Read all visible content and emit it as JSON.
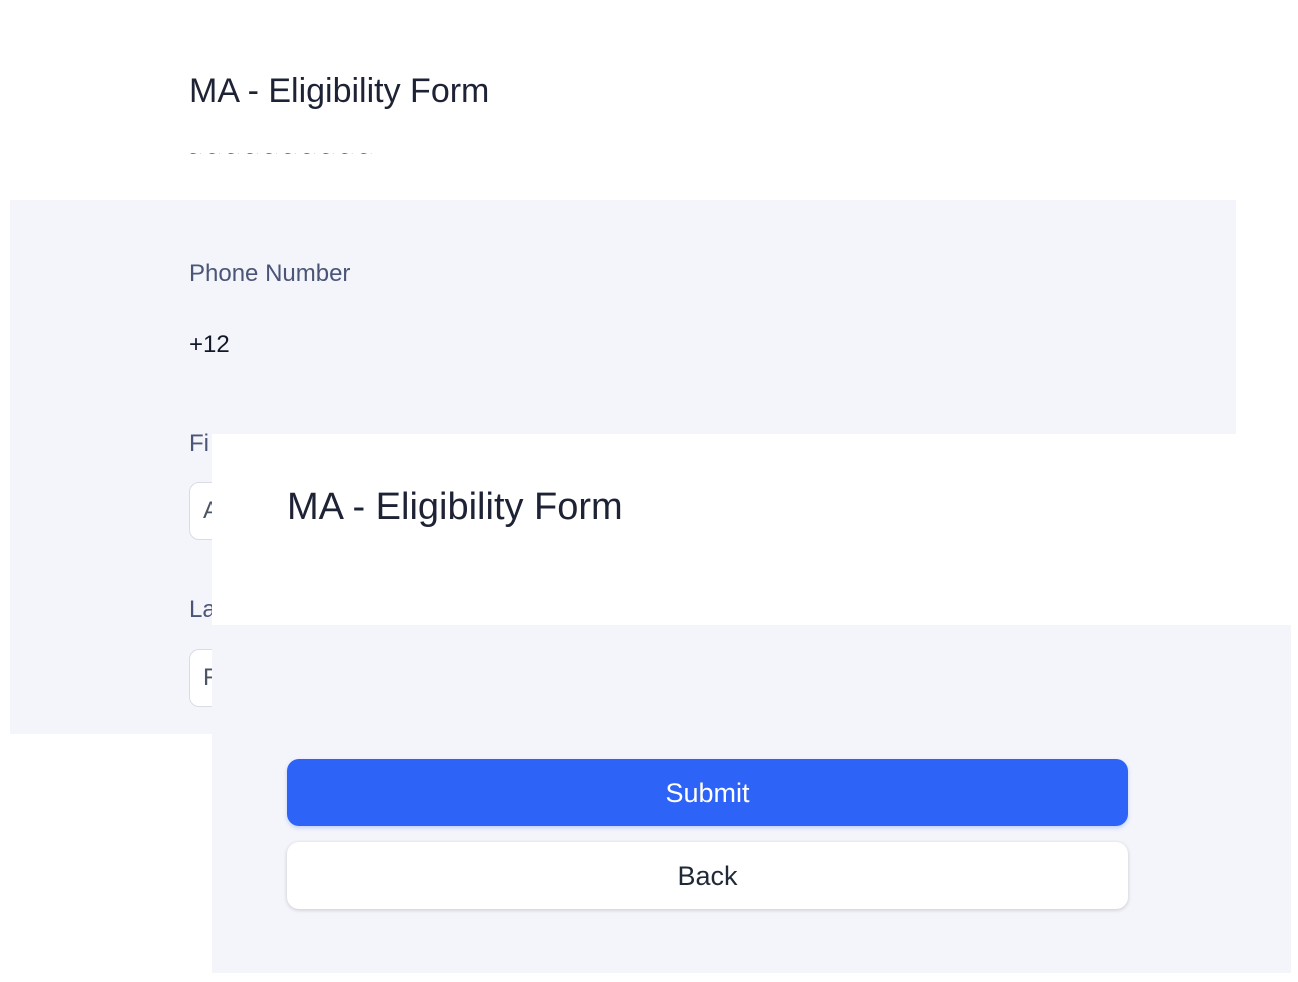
{
  "background_screen": {
    "title": "MA - Eligibility Form",
    "subtitle_partial": "~ ~ ~ ~ ~ ~ ~ ~ ~ ~",
    "fields": {
      "phone": {
        "label": "Phone Number",
        "value": "+12"
      },
      "first_name": {
        "label": "Fi",
        "value": "A"
      },
      "last_name": {
        "label": "La",
        "value": "F"
      }
    }
  },
  "foreground_screen": {
    "title": "MA - Eligibility Form",
    "submit_label": "Submit",
    "back_label": "Back"
  },
  "colors": {
    "primary": "#2d63f6",
    "panel_background": "#f4f5fa",
    "label_text": "#4b5577"
  }
}
